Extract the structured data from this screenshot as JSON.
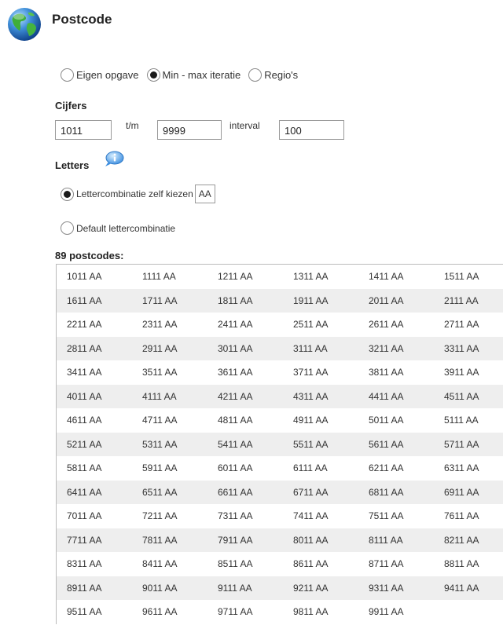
{
  "header": {
    "title": "Postcode",
    "icon": "globe-icon"
  },
  "mode": {
    "options": [
      {
        "label": "Eigen opgave",
        "checked": false
      },
      {
        "label": "Min - max iteratie",
        "checked": true
      },
      {
        "label": "Regio's",
        "checked": false
      }
    ]
  },
  "cijfers": {
    "heading": "Cijfers",
    "from_value": "1011",
    "tm_label": "t/m",
    "to_value": "9999",
    "interval_label": "interval",
    "interval_value": "100"
  },
  "letters": {
    "heading": "Letters",
    "info_icon": "info-icon",
    "choose_label": "Lettercombinatie zelf kiezen",
    "choose_checked": true,
    "choose_value": "AA",
    "default_label": "Default lettercombinatie",
    "default_checked": false
  },
  "results": {
    "count_label": "89 postcodes:",
    "rows": [
      [
        "1011 AA",
        "1111 AA",
        "1211 AA",
        "1311 AA",
        "1411 AA",
        "1511 AA"
      ],
      [
        "1611 AA",
        "1711 AA",
        "1811 AA",
        "1911 AA",
        "2011 AA",
        "2111 AA"
      ],
      [
        "2211 AA",
        "2311 AA",
        "2411 AA",
        "2511 AA",
        "2611 AA",
        "2711 AA"
      ],
      [
        "2811 AA",
        "2911 AA",
        "3011 AA",
        "3111 AA",
        "3211 AA",
        "3311 AA"
      ],
      [
        "3411 AA",
        "3511 AA",
        "3611 AA",
        "3711 AA",
        "3811 AA",
        "3911 AA"
      ],
      [
        "4011 AA",
        "4111 AA",
        "4211 AA",
        "4311 AA",
        "4411 AA",
        "4511 AA"
      ],
      [
        "4611 AA",
        "4711 AA",
        "4811 AA",
        "4911 AA",
        "5011 AA",
        "5111 AA"
      ],
      [
        "5211 AA",
        "5311 AA",
        "5411 AA",
        "5511 AA",
        "5611 AA",
        "5711 AA"
      ],
      [
        "5811 AA",
        "5911 AA",
        "6011 AA",
        "6111 AA",
        "6211 AA",
        "6311 AA"
      ],
      [
        "6411 AA",
        "6511 AA",
        "6611 AA",
        "6711 AA",
        "6811 AA",
        "6911 AA"
      ],
      [
        "7011 AA",
        "7211 AA",
        "7311 AA",
        "7411 AA",
        "7511 AA",
        "7611 AA"
      ],
      [
        "7711 AA",
        "7811 AA",
        "7911 AA",
        "8011 AA",
        "8111 AA",
        "8211 AA"
      ],
      [
        "8311 AA",
        "8411 AA",
        "8511 AA",
        "8611 AA",
        "8711 AA",
        "8811 AA"
      ],
      [
        "8911 AA",
        "9011 AA",
        "9111 AA",
        "9211 AA",
        "9311 AA",
        "9411 AA"
      ],
      [
        "9511 AA",
        "9611 AA",
        "9711 AA",
        "9811 AA",
        "9911 AA"
      ]
    ]
  }
}
